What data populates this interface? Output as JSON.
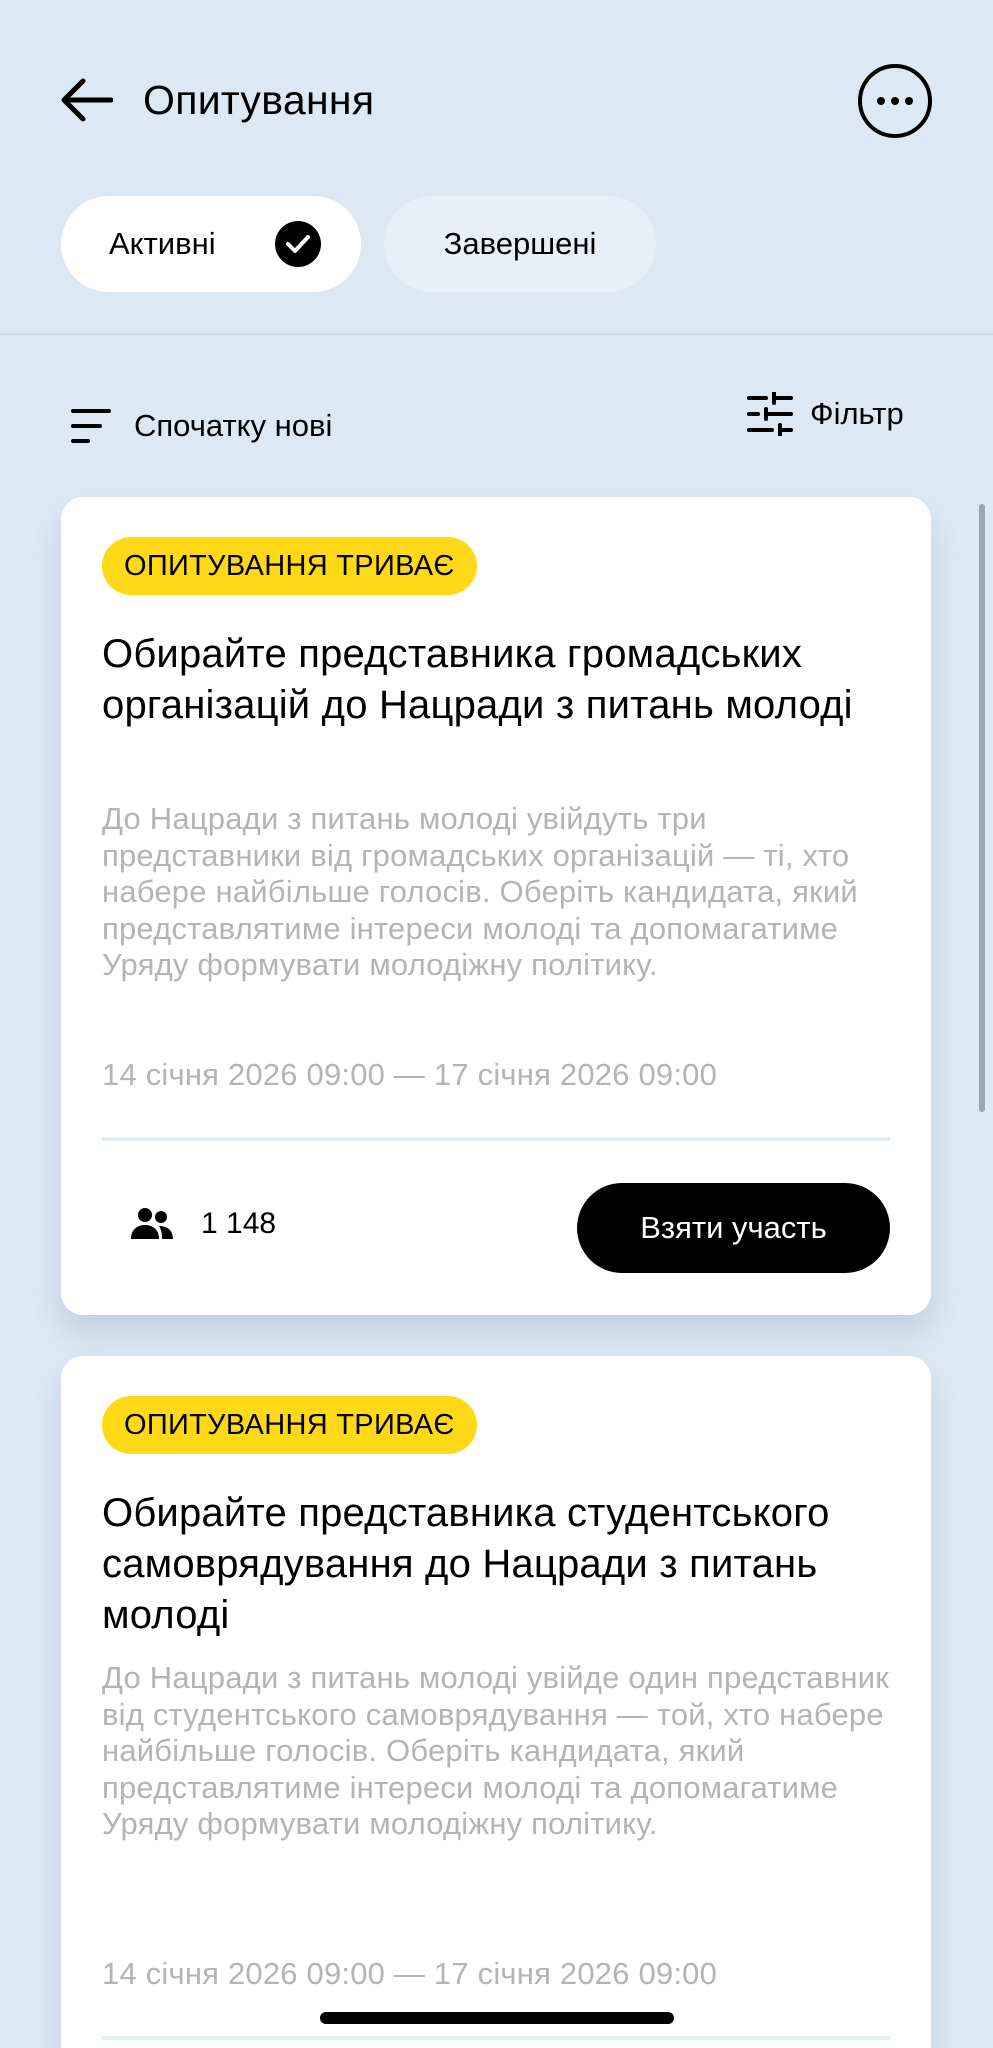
{
  "header": {
    "title": "Опитування",
    "back_icon": "arrow-left-icon",
    "more_icon": "more-horizontal-icon"
  },
  "tabs": [
    {
      "label": "Активні",
      "active": true
    },
    {
      "label": "Завершені",
      "active": false
    }
  ],
  "toolbar": {
    "sort_label": "Спочатку нові",
    "filter_label": "Фільтр"
  },
  "polls": [
    {
      "status": "ОПИТУВАННЯ ТРИВАЄ",
      "title": "Обирайте представника громадських організацій до Нацради з питань молоді",
      "description": "До Нацради з питань молоді увійдуть три представники від громадських організацій — ті, хто набере найбільше голосів. Оберіть кандидата, який представлятиме інтереси молоді та допомагатиме Уряду формувати молодіжну політику.",
      "dates": "14 січня 2026 09:00 — 17 січня 2026 09:00",
      "participants": "1 148",
      "action_label": "Взяти участь"
    },
    {
      "status": "ОПИТУВАННЯ ТРИВАЄ",
      "title": "Обирайте представника студентського самоврядування до Нацради з питань молоді",
      "description": "До Нацради з питань молоді увійде один представник від студентського самоврядування — той, хто набере найбільше голосів. Оберіть кандидата, який представлятиме інтереси молоді та допомагатиме Уряду формувати молодіжну політику.",
      "dates": "14 січня 2026 09:00 — 17 січня 2026 09:00"
    }
  ],
  "colors": {
    "background": "#dce8f4",
    "badge": "#ffd918",
    "primary_button": "#000000",
    "muted_text": "#b4b4b4"
  }
}
